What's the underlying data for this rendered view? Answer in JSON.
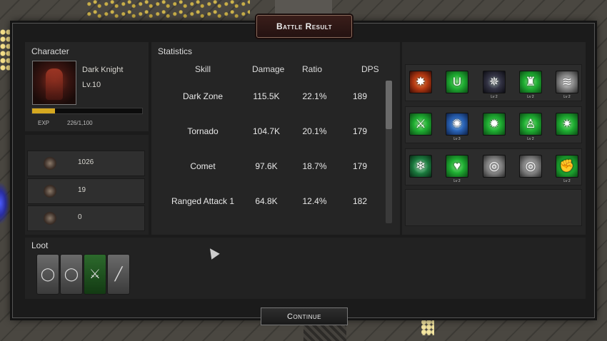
{
  "window": {
    "title": "Battle Result",
    "continue_label": "Continue"
  },
  "character": {
    "heading": "Character",
    "class_name": "Dark Knight",
    "level": "Lv.10",
    "exp_label": "EXP",
    "exp_value": "226/1,100",
    "exp_fraction": 0.205,
    "resources": [
      {
        "icon": "skull-coin-icon",
        "value": "1026"
      },
      {
        "icon": "crest-shield-icon",
        "value": "19"
      },
      {
        "icon": "demon-emblem-icon",
        "value": "0"
      }
    ]
  },
  "statistics": {
    "heading": "Statistics",
    "columns": [
      "Skill",
      "Damage",
      "Ratio",
      "DPS"
    ],
    "rows": [
      {
        "skill": "Dark Zone",
        "damage": "115.5K",
        "ratio": "22.1%",
        "dps": "189"
      },
      {
        "skill": "Tornado",
        "damage": "104.7K",
        "ratio": "20.1%",
        "dps": "179"
      },
      {
        "skill": "Comet",
        "damage": "97.6K",
        "ratio": "18.7%",
        "dps": "179"
      },
      {
        "skill": "Ranged Attack 1",
        "damage": "64.8K",
        "ratio": "12.4%",
        "dps": "182"
      }
    ]
  },
  "skills": [
    [
      {
        "icon": "fire-claw-icon",
        "level": ""
      },
      {
        "icon": "magnet-icon",
        "level": ""
      },
      {
        "icon": "compass-star-icon",
        "level": "Lv 2"
      },
      {
        "icon": "shielded-figure-icon",
        "level": "Lv 2"
      },
      {
        "icon": "tornado-icon",
        "level": "Lv 2"
      }
    ],
    [
      {
        "icon": "sword-up-icon",
        "level": ""
      },
      {
        "icon": "orbit-globe-icon",
        "level": "Lv 3"
      },
      {
        "icon": "burst-icon",
        "level": ""
      },
      {
        "icon": "figure-up-icon",
        "level": "Lv 2"
      },
      {
        "icon": "starburst-up-icon",
        "level": ""
      }
    ],
    [
      {
        "icon": "snowflake-icon",
        "level": ""
      },
      {
        "icon": "heart-plus-icon",
        "level": "Lv 2"
      },
      {
        "icon": "ring-swirl-icon",
        "level": ""
      },
      {
        "icon": "ring-swirl-icon",
        "level": ""
      },
      {
        "icon": "fist-up-icon",
        "level": "Lv 2"
      }
    ]
  ],
  "loot": {
    "heading": "Loot",
    "items": [
      {
        "icon": "ring-icon",
        "rarity": "common"
      },
      {
        "icon": "ring-icon",
        "rarity": "common"
      },
      {
        "icon": "sword-icon",
        "rarity": "uncommon"
      },
      {
        "icon": "staff-icon",
        "rarity": "common"
      }
    ]
  },
  "colors": {
    "exp_fill": "#d5a820",
    "uncommon": "#2c6a2c",
    "title_plate": "#3a1e1a"
  }
}
